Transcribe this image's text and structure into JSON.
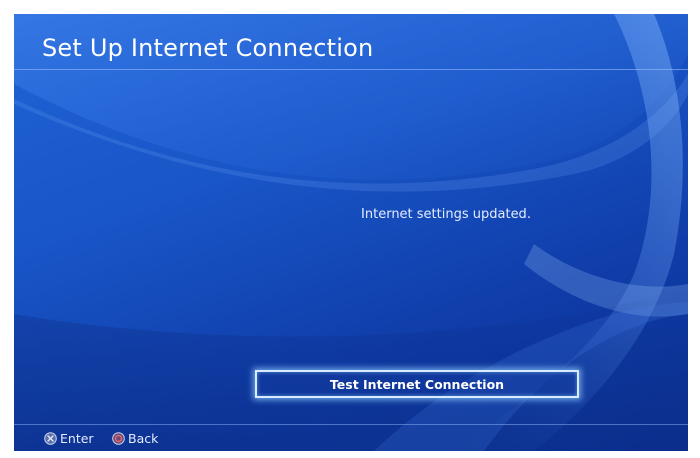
{
  "header": {
    "title": "Set Up Internet Connection"
  },
  "main": {
    "message": "Internet settings updated.",
    "primary_button_label": "Test Internet Connection"
  },
  "footer": {
    "enter": {
      "icon": "cross-button-icon",
      "label": "Enter"
    },
    "back": {
      "icon": "circle-button-icon",
      "label": "Back"
    }
  },
  "colors": {
    "background_blue": "#1956c8",
    "button_glow": "#d8ecff",
    "text": "#ffffff"
  }
}
